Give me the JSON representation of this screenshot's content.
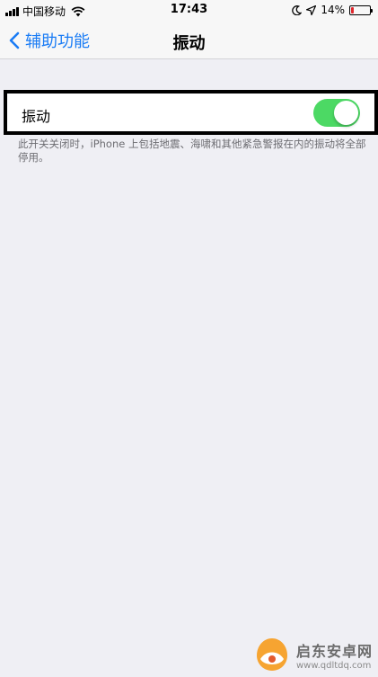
{
  "status_bar": {
    "carrier": "中国移动",
    "time": "17:43",
    "battery_percent": "14%",
    "battery_level": 0.14,
    "icons": [
      "signal-icon",
      "wifi-icon",
      "moon-icon",
      "location-icon",
      "battery-icon"
    ]
  },
  "nav": {
    "back_label": "辅助功能",
    "title": "振动"
  },
  "setting": {
    "label": "振动",
    "toggle_on": true
  },
  "footer_note": "此开关关闭时，iPhone 上包括地震、海啸和其他紧急警报在内的振动将全部停用。",
  "watermark": {
    "title": "启东安卓网",
    "url": "www.qdltdq.com"
  },
  "colors": {
    "accent": "#1a7cf5",
    "toggle_on": "#4cd964",
    "background": "#efeff4",
    "battery_low": "#e0262c"
  }
}
